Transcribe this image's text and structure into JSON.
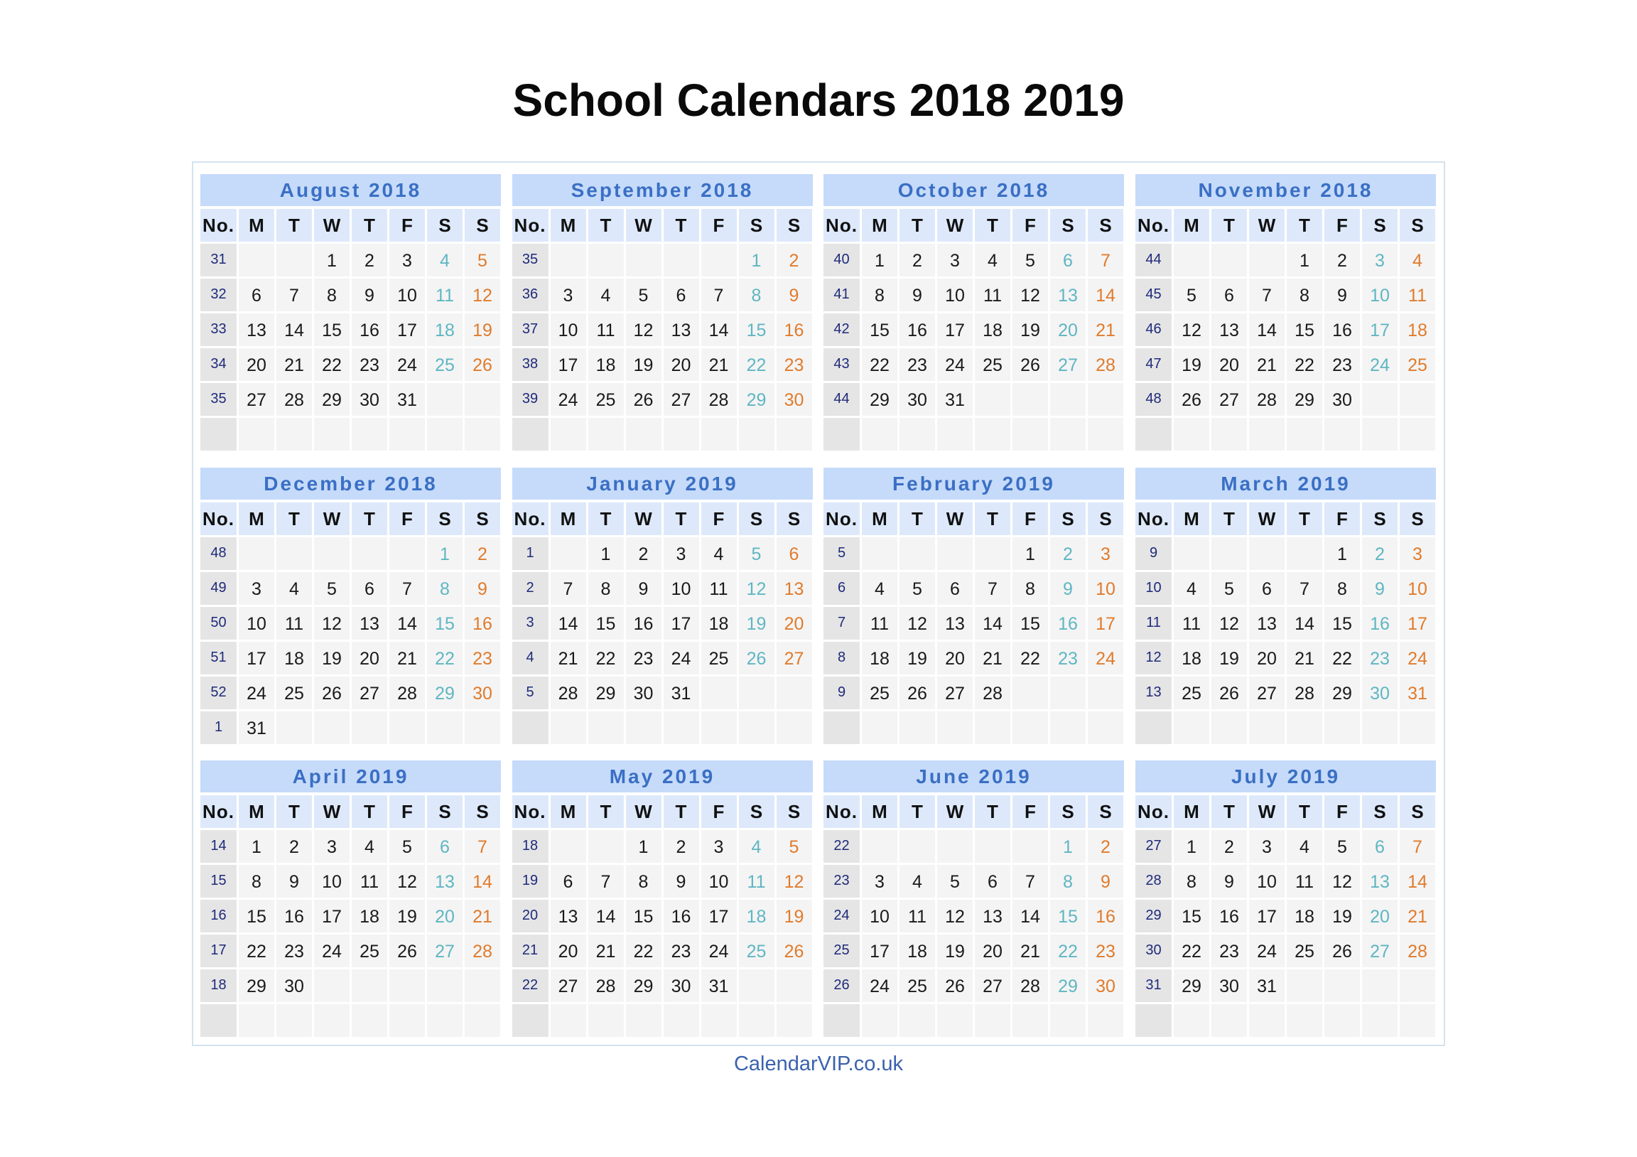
{
  "title": "School Calendars 2018 2019",
  "footer": "CalendarVIP.co.uk",
  "colors": {
    "month_header_bg": "#c6dbfa",
    "month_title": "#3a6fc4",
    "day_header_bg": "#dde9fb",
    "cell_bg": "#f4f4f4",
    "week_col_bg": "#e5e5e5",
    "week_number": "#1f2a7a",
    "saturday": "#5fb6c2",
    "sunday": "#e07b2c",
    "footer": "#3b62ad"
  },
  "day_headers": [
    "No.",
    "M",
    "T",
    "W",
    "T",
    "F",
    "S",
    "S"
  ],
  "months": [
    {
      "name": "August 2018",
      "weeks": [
        {
          "no": "31",
          "days": [
            "",
            "",
            "1",
            "2",
            "3",
            "4",
            "5"
          ]
        },
        {
          "no": "32",
          "days": [
            "6",
            "7",
            "8",
            "9",
            "10",
            "11",
            "12"
          ]
        },
        {
          "no": "33",
          "days": [
            "13",
            "14",
            "15",
            "16",
            "17",
            "18",
            "19"
          ]
        },
        {
          "no": "34",
          "days": [
            "20",
            "21",
            "22",
            "23",
            "24",
            "25",
            "26"
          ]
        },
        {
          "no": "35",
          "days": [
            "27",
            "28",
            "29",
            "30",
            "31",
            "",
            ""
          ]
        },
        {
          "no": "",
          "days": [
            "",
            "",
            "",
            "",
            "",
            "",
            ""
          ]
        }
      ]
    },
    {
      "name": "September 2018",
      "weeks": [
        {
          "no": "35",
          "days": [
            "",
            "",
            "",
            "",
            "",
            "1",
            "2"
          ]
        },
        {
          "no": "36",
          "days": [
            "3",
            "4",
            "5",
            "6",
            "7",
            "8",
            "9"
          ]
        },
        {
          "no": "37",
          "days": [
            "10",
            "11",
            "12",
            "13",
            "14",
            "15",
            "16"
          ]
        },
        {
          "no": "38",
          "days": [
            "17",
            "18",
            "19",
            "20",
            "21",
            "22",
            "23"
          ]
        },
        {
          "no": "39",
          "days": [
            "24",
            "25",
            "26",
            "27",
            "28",
            "29",
            "30"
          ]
        },
        {
          "no": "",
          "days": [
            "",
            "",
            "",
            "",
            "",
            "",
            ""
          ]
        }
      ]
    },
    {
      "name": "October 2018",
      "weeks": [
        {
          "no": "40",
          "days": [
            "1",
            "2",
            "3",
            "4",
            "5",
            "6",
            "7"
          ]
        },
        {
          "no": "41",
          "days": [
            "8",
            "9",
            "10",
            "11",
            "12",
            "13",
            "14"
          ]
        },
        {
          "no": "42",
          "days": [
            "15",
            "16",
            "17",
            "18",
            "19",
            "20",
            "21"
          ]
        },
        {
          "no": "43",
          "days": [
            "22",
            "23",
            "24",
            "25",
            "26",
            "27",
            "28"
          ]
        },
        {
          "no": "44",
          "days": [
            "29",
            "30",
            "31",
            "",
            "",
            "",
            ""
          ]
        },
        {
          "no": "",
          "days": [
            "",
            "",
            "",
            "",
            "",
            "",
            ""
          ]
        }
      ]
    },
    {
      "name": "November 2018",
      "weeks": [
        {
          "no": "44",
          "days": [
            "",
            "",
            "",
            "1",
            "2",
            "3",
            "4"
          ]
        },
        {
          "no": "45",
          "days": [
            "5",
            "6",
            "7",
            "8",
            "9",
            "10",
            "11"
          ]
        },
        {
          "no": "46",
          "days": [
            "12",
            "13",
            "14",
            "15",
            "16",
            "17",
            "18"
          ]
        },
        {
          "no": "47",
          "days": [
            "19",
            "20",
            "21",
            "22",
            "23",
            "24",
            "25"
          ]
        },
        {
          "no": "48",
          "days": [
            "26",
            "27",
            "28",
            "29",
            "30",
            "",
            ""
          ]
        },
        {
          "no": "",
          "days": [
            "",
            "",
            "",
            "",
            "",
            "",
            ""
          ]
        }
      ]
    },
    {
      "name": "December 2018",
      "weeks": [
        {
          "no": "48",
          "days": [
            "",
            "",
            "",
            "",
            "",
            "1",
            "2"
          ]
        },
        {
          "no": "49",
          "days": [
            "3",
            "4",
            "5",
            "6",
            "7",
            "8",
            "9"
          ]
        },
        {
          "no": "50",
          "days": [
            "10",
            "11",
            "12",
            "13",
            "14",
            "15",
            "16"
          ]
        },
        {
          "no": "51",
          "days": [
            "17",
            "18",
            "19",
            "20",
            "21",
            "22",
            "23"
          ]
        },
        {
          "no": "52",
          "days": [
            "24",
            "25",
            "26",
            "27",
            "28",
            "29",
            "30"
          ]
        },
        {
          "no": "1",
          "days": [
            "31",
            "",
            "",
            "",
            "",
            "",
            ""
          ]
        }
      ]
    },
    {
      "name": "January 2019",
      "weeks": [
        {
          "no": "1",
          "days": [
            "",
            "1",
            "2",
            "3",
            "4",
            "5",
            "6"
          ]
        },
        {
          "no": "2",
          "days": [
            "7",
            "8",
            "9",
            "10",
            "11",
            "12",
            "13"
          ]
        },
        {
          "no": "3",
          "days": [
            "14",
            "15",
            "16",
            "17",
            "18",
            "19",
            "20"
          ]
        },
        {
          "no": "4",
          "days": [
            "21",
            "22",
            "23",
            "24",
            "25",
            "26",
            "27"
          ]
        },
        {
          "no": "5",
          "days": [
            "28",
            "29",
            "30",
            "31",
            "",
            "",
            ""
          ]
        },
        {
          "no": "",
          "days": [
            "",
            "",
            "",
            "",
            "",
            "",
            ""
          ]
        }
      ]
    },
    {
      "name": "February 2019",
      "weeks": [
        {
          "no": "5",
          "days": [
            "",
            "",
            "",
            "",
            "1",
            "2",
            "3"
          ]
        },
        {
          "no": "6",
          "days": [
            "4",
            "5",
            "6",
            "7",
            "8",
            "9",
            "10"
          ]
        },
        {
          "no": "7",
          "days": [
            "11",
            "12",
            "13",
            "14",
            "15",
            "16",
            "17"
          ]
        },
        {
          "no": "8",
          "days": [
            "18",
            "19",
            "20",
            "21",
            "22",
            "23",
            "24"
          ]
        },
        {
          "no": "9",
          "days": [
            "25",
            "26",
            "27",
            "28",
            "",
            "",
            ""
          ]
        },
        {
          "no": "",
          "days": [
            "",
            "",
            "",
            "",
            "",
            "",
            ""
          ]
        }
      ]
    },
    {
      "name": "March 2019",
      "weeks": [
        {
          "no": "9",
          "days": [
            "",
            "",
            "",
            "",
            "1",
            "2",
            "3"
          ]
        },
        {
          "no": "10",
          "days": [
            "4",
            "5",
            "6",
            "7",
            "8",
            "9",
            "10"
          ]
        },
        {
          "no": "11",
          "days": [
            "11",
            "12",
            "13",
            "14",
            "15",
            "16",
            "17"
          ]
        },
        {
          "no": "12",
          "days": [
            "18",
            "19",
            "20",
            "21",
            "22",
            "23",
            "24"
          ]
        },
        {
          "no": "13",
          "days": [
            "25",
            "26",
            "27",
            "28",
            "29",
            "30",
            "31"
          ]
        },
        {
          "no": "",
          "days": [
            "",
            "",
            "",
            "",
            "",
            "",
            ""
          ]
        }
      ]
    },
    {
      "name": "April 2019",
      "weeks": [
        {
          "no": "14",
          "days": [
            "1",
            "2",
            "3",
            "4",
            "5",
            "6",
            "7"
          ]
        },
        {
          "no": "15",
          "days": [
            "8",
            "9",
            "10",
            "11",
            "12",
            "13",
            "14"
          ]
        },
        {
          "no": "16",
          "days": [
            "15",
            "16",
            "17",
            "18",
            "19",
            "20",
            "21"
          ]
        },
        {
          "no": "17",
          "days": [
            "22",
            "23",
            "24",
            "25",
            "26",
            "27",
            "28"
          ]
        },
        {
          "no": "18",
          "days": [
            "29",
            "30",
            "",
            "",
            "",
            "",
            ""
          ]
        },
        {
          "no": "",
          "days": [
            "",
            "",
            "",
            "",
            "",
            "",
            ""
          ]
        }
      ]
    },
    {
      "name": "May 2019",
      "weeks": [
        {
          "no": "18",
          "days": [
            "",
            "",
            "1",
            "2",
            "3",
            "4",
            "5"
          ]
        },
        {
          "no": "19",
          "days": [
            "6",
            "7",
            "8",
            "9",
            "10",
            "11",
            "12"
          ]
        },
        {
          "no": "20",
          "days": [
            "13",
            "14",
            "15",
            "16",
            "17",
            "18",
            "19"
          ]
        },
        {
          "no": "21",
          "days": [
            "20",
            "21",
            "22",
            "23",
            "24",
            "25",
            "26"
          ]
        },
        {
          "no": "22",
          "days": [
            "27",
            "28",
            "29",
            "30",
            "31",
            "",
            ""
          ]
        },
        {
          "no": "",
          "days": [
            "",
            "",
            "",
            "",
            "",
            "",
            ""
          ]
        }
      ]
    },
    {
      "name": "June 2019",
      "weeks": [
        {
          "no": "22",
          "days": [
            "",
            "",
            "",
            "",
            "",
            "1",
            "2"
          ]
        },
        {
          "no": "23",
          "days": [
            "3",
            "4",
            "5",
            "6",
            "7",
            "8",
            "9"
          ]
        },
        {
          "no": "24",
          "days": [
            "10",
            "11",
            "12",
            "13",
            "14",
            "15",
            "16"
          ]
        },
        {
          "no": "25",
          "days": [
            "17",
            "18",
            "19",
            "20",
            "21",
            "22",
            "23"
          ]
        },
        {
          "no": "26",
          "days": [
            "24",
            "25",
            "26",
            "27",
            "28",
            "29",
            "30"
          ]
        },
        {
          "no": "",
          "days": [
            "",
            "",
            "",
            "",
            "",
            "",
            ""
          ]
        }
      ]
    },
    {
      "name": "July 2019",
      "weeks": [
        {
          "no": "27",
          "days": [
            "1",
            "2",
            "3",
            "4",
            "5",
            "6",
            "7"
          ]
        },
        {
          "no": "28",
          "days": [
            "8",
            "9",
            "10",
            "11",
            "12",
            "13",
            "14"
          ]
        },
        {
          "no": "29",
          "days": [
            "15",
            "16",
            "17",
            "18",
            "19",
            "20",
            "21"
          ]
        },
        {
          "no": "30",
          "days": [
            "22",
            "23",
            "24",
            "25",
            "26",
            "27",
            "28"
          ]
        },
        {
          "no": "31",
          "days": [
            "29",
            "30",
            "31",
            "",
            "",
            "",
            ""
          ]
        },
        {
          "no": "",
          "days": [
            "",
            "",
            "",
            "",
            "",
            "",
            ""
          ]
        }
      ]
    }
  ]
}
